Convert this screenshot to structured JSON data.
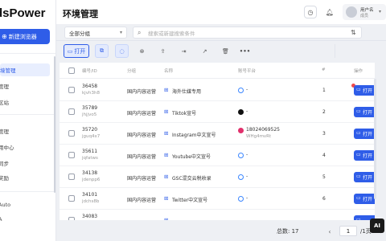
{
  "sidebar": {
    "logo": "dsPower",
    "new_env": "新建浏览器",
    "items": [
      {
        "label": "境管理",
        "active": true
      },
      {
        "label": "管理",
        "active": false
      },
      {
        "label": "区站",
        "active": false
      },
      {
        "label": "管理",
        "active": false
      },
      {
        "label": "用中心",
        "active": false
      },
      {
        "label": "同步",
        "active": false
      },
      {
        "label": "奖励",
        "active": false
      },
      {
        "label": "Auto",
        "active": false
      },
      {
        "label": "A",
        "active": false
      }
    ]
  },
  "header": {
    "title": "环境管理",
    "user_name": "用户名",
    "user_role": "成员"
  },
  "filter": {
    "group_select": "全部分组",
    "search_placeholder": "搜索或新建搜索条件"
  },
  "toolbar": {
    "open_label": "打开"
  },
  "table": {
    "headers": [
      "编号/ID",
      "分组",
      "名称",
      "账号平台",
      "#",
      "操作"
    ],
    "rows": [
      {
        "num": "36458",
        "id": "kjvh3h8",
        "group": "国内内容运营",
        "name": "海外仕媒专用",
        "platform": "globe",
        "platform_text": "-",
        "seq": "1",
        "op": "打开",
        "badge": true
      },
      {
        "num": "35789",
        "id": "jhjjvo5",
        "group": "国内内容运营",
        "name": "Tiktok宣号",
        "platform": "tiktok",
        "platform_text": "-",
        "seq": "2",
        "op": "打开",
        "badge": false
      },
      {
        "num": "35720",
        "id": "jguq4x7",
        "group": "国内内容运营",
        "name": "Instagram中文宣号",
        "platform": "insta",
        "platform_text": "18024069525",
        "platform_sub": "WHg4mvRt",
        "seq": "3",
        "op": "打开",
        "badge": false
      },
      {
        "num": "35611",
        "id": "jqfatws",
        "group": "国内内容运营",
        "name": "Youtube中文宣号",
        "platform": "globe",
        "platform_text": "-",
        "seq": "4",
        "op": "打开",
        "badge": false
      },
      {
        "num": "34138",
        "id": "jdenpp6",
        "group": "国内内容运营",
        "name": "GSC混交云税收录",
        "platform": "globe",
        "platform_text": "-",
        "seq": "5",
        "op": "打开",
        "badge": false
      },
      {
        "num": "34101",
        "id": "jdchs8b",
        "group": "国内内容运营",
        "name": "Twitter中文宣号",
        "platform": "globe",
        "platform_text": "-",
        "seq": "6",
        "op": "打开",
        "badge": false
      },
      {
        "num": "34083",
        "id": "",
        "group": "",
        "name": "",
        "platform": "",
        "platform_text": "",
        "seq": "",
        "op": "",
        "badge": false
      }
    ]
  },
  "pagination": {
    "total": "总数: 17",
    "page": "1",
    "of": "/1页"
  },
  "ai_badge": "AI"
}
